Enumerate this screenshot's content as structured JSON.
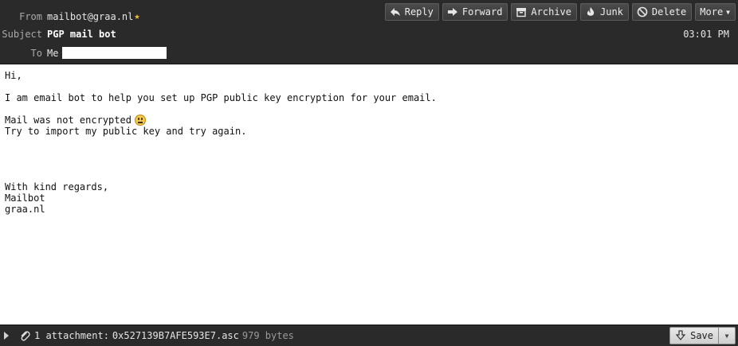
{
  "header": {
    "from_label": "From",
    "from_value": "mailbot@graa.nl",
    "subject_label": "Subject",
    "subject_value": "PGP mail bot",
    "to_label": "To",
    "to_value": "Me",
    "time": "03:01 PM"
  },
  "toolbar": {
    "reply": "Reply",
    "forward": "Forward",
    "archive": "Archive",
    "junk": "Junk",
    "delete": "Delete",
    "more": "More"
  },
  "body": {
    "greeting": "Hi,",
    "intro": "I am email bot to help you set up PGP public key encryption for your email.",
    "status": "Mail was not encrypted",
    "instruction": "Try to import my public key and try again.",
    "closing": "With kind regards,",
    "signature_name": "Mailbot",
    "signature_domain": "graa.nl"
  },
  "attachment": {
    "count_label": "1 attachment:",
    "filename": "0x527139B7AFE593E7.asc",
    "size": "979 bytes",
    "save": "Save"
  },
  "icons": {
    "star": "star-icon",
    "reply": "reply-arrow-icon",
    "forward": "forward-arrow-icon",
    "archive": "archive-box-icon",
    "junk": "junk-flame-icon",
    "delete": "delete-circle-icon",
    "emoji": "worried-face-emoji",
    "clip": "paperclip-icon",
    "save": "download-arrow-icon"
  },
  "colors": {
    "header_bg": "#2a2a2a",
    "star": "#f1c232",
    "body_bg": "#ffffff"
  }
}
